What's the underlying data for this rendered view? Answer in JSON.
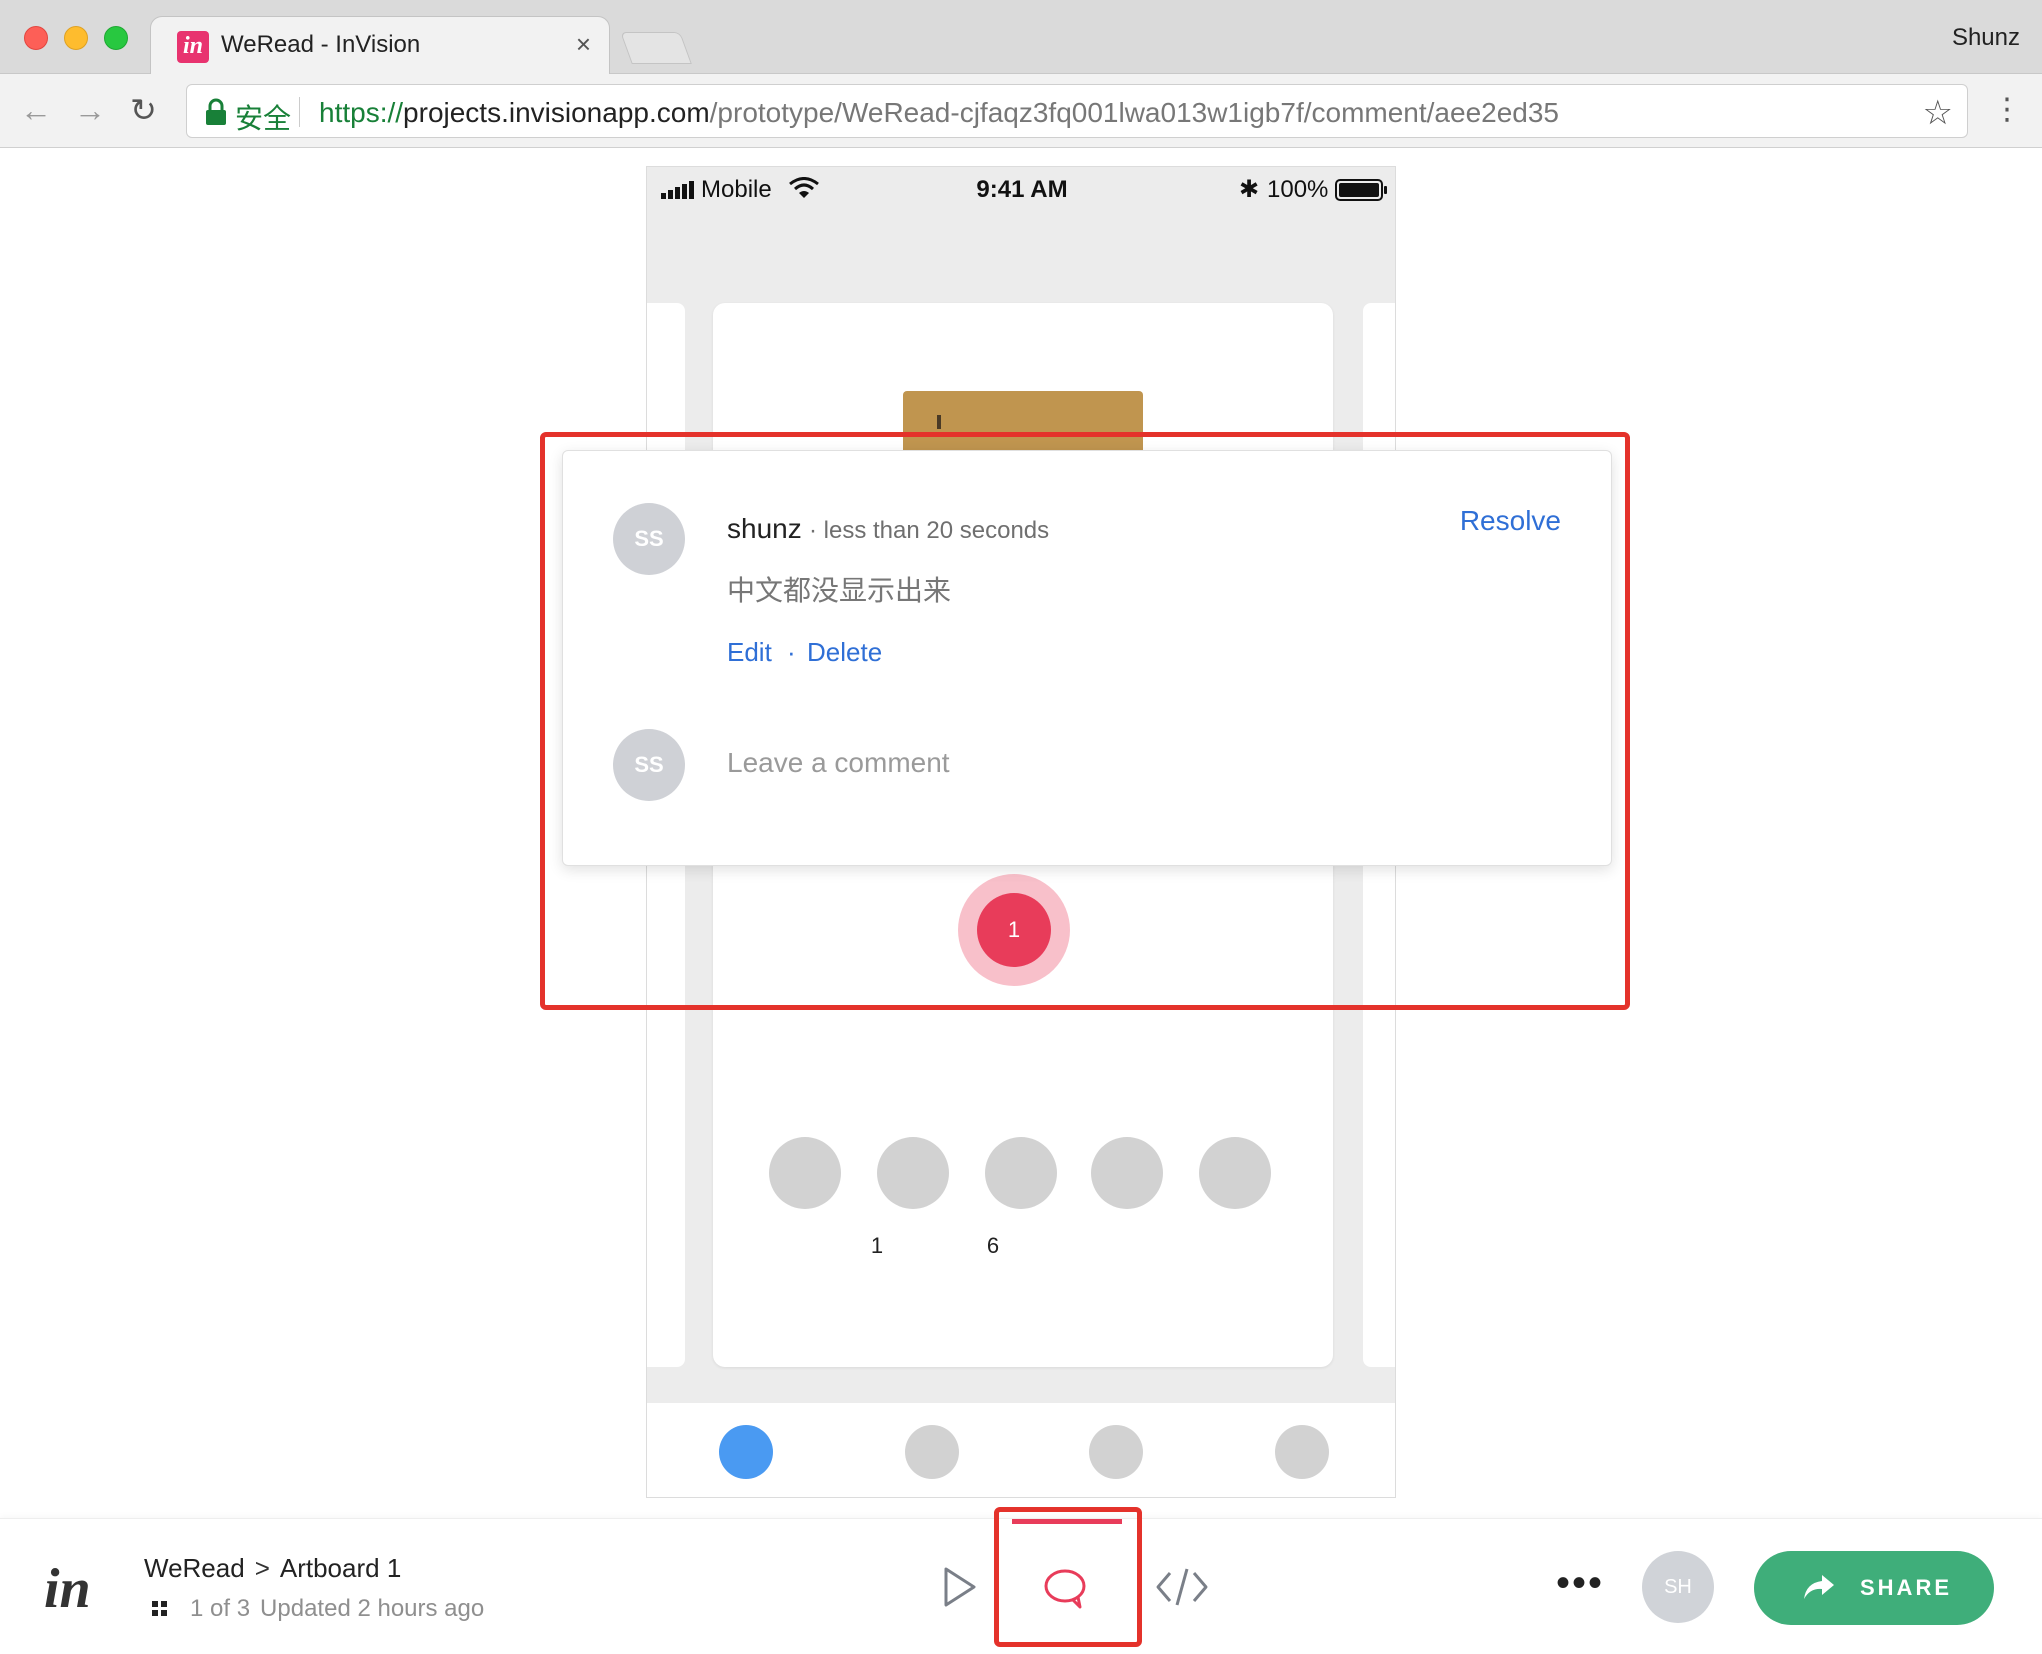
{
  "browser": {
    "tab_title": "WeRead - InVision",
    "tab_favicon": "in",
    "tab_close": "×",
    "profile_name": "Shunz",
    "secure_label": "安全",
    "url": {
      "scheme": "https://",
      "host": "projects.invisionapp.com",
      "path": "/prototype/WeRead-cjfaqz3fq001lwa013w1igb7f/comment/aee2ed35"
    },
    "icons": {
      "back": "←",
      "forward": "→",
      "reload": "↻",
      "star": "☆",
      "menu": "⋮"
    }
  },
  "status_bar": {
    "carrier": "Mobile",
    "time": "9:41 AM",
    "bluetooth": "✱",
    "battery": "100%"
  },
  "prototype": {
    "dot_labels": [
      "1",
      "6"
    ],
    "tab_active_color": "#4a9af2",
    "tab_inactive_color": "#d2d2d2"
  },
  "comment": {
    "avatar": "SS",
    "author": "shunz",
    "meta": "· less than 20 seconds",
    "resolve": "Resolve",
    "body": "中文都没显示出来",
    "edit": "Edit",
    "separator": "·",
    "delete": "Delete",
    "reply_avatar": "SS",
    "reply_placeholder": "Leave a comment",
    "pin_number": "1"
  },
  "bottom_bar": {
    "logo": "in",
    "project": "WeRead",
    "chevron": ">",
    "screen": "Artboard 1",
    "page_count": "1 of 3",
    "updated": "Updated 2 hours ago",
    "more": "•••",
    "user_avatar": "SH",
    "share_label": "SHARE",
    "share_color": "#3fae7a",
    "accent_color": "#e83c5a"
  }
}
